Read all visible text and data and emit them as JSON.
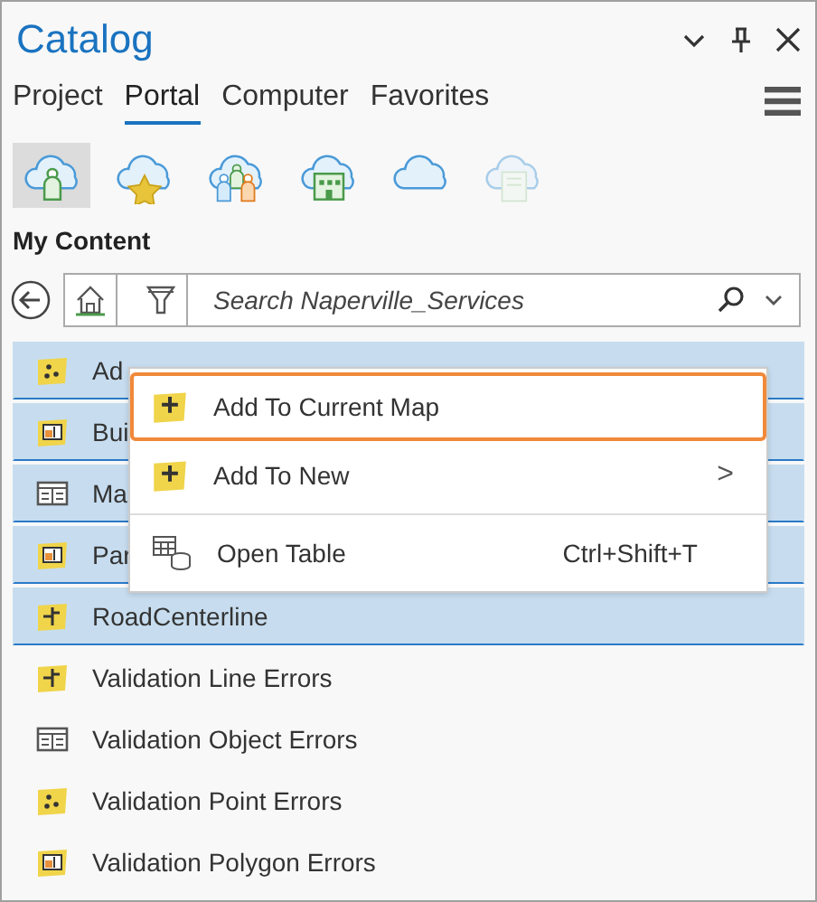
{
  "window": {
    "title": "Catalog"
  },
  "tabs": [
    {
      "label": "Project",
      "selected": false
    },
    {
      "label": "Portal",
      "selected": true
    },
    {
      "label": "Computer",
      "selected": false
    },
    {
      "label": "Favorites",
      "selected": false
    }
  ],
  "portal_buttons": [
    {
      "kind": "person",
      "selected": true,
      "disabled": false
    },
    {
      "kind": "star",
      "selected": false,
      "disabled": false
    },
    {
      "kind": "group",
      "selected": false,
      "disabled": false
    },
    {
      "kind": "building",
      "selected": false,
      "disabled": false
    },
    {
      "kind": "cloud",
      "selected": false,
      "disabled": false
    },
    {
      "kind": "book",
      "selected": false,
      "disabled": true
    }
  ],
  "section_title": "My Content",
  "search": {
    "placeholder": "Search Naperville_Services"
  },
  "items": [
    {
      "name": "Ad",
      "kind": "point",
      "selected": true
    },
    {
      "name": "Bui",
      "kind": "polygon",
      "selected": true
    },
    {
      "name": "Ma",
      "kind": "table",
      "selected": true
    },
    {
      "name": "Par",
      "kind": "polygon",
      "selected": true
    },
    {
      "name": "RoadCenterline",
      "kind": "line",
      "selected": true
    },
    {
      "name": "Validation Line Errors",
      "kind": "line",
      "selected": false
    },
    {
      "name": "Validation Object Errors",
      "kind": "table",
      "selected": false
    },
    {
      "name": "Validation Point Errors",
      "kind": "point",
      "selected": false
    },
    {
      "name": "Validation Polygon Errors",
      "kind": "polygon",
      "selected": false
    }
  ],
  "context_menu": [
    {
      "label": "Add To Current Map",
      "kind": "add",
      "selected": true
    },
    {
      "label": "Add To New",
      "kind": "add",
      "selected": false,
      "arrow": ">"
    },
    {
      "label": "Open Table",
      "kind": "table",
      "selected": false,
      "shortcut": "Ctrl+Shift+T"
    }
  ]
}
